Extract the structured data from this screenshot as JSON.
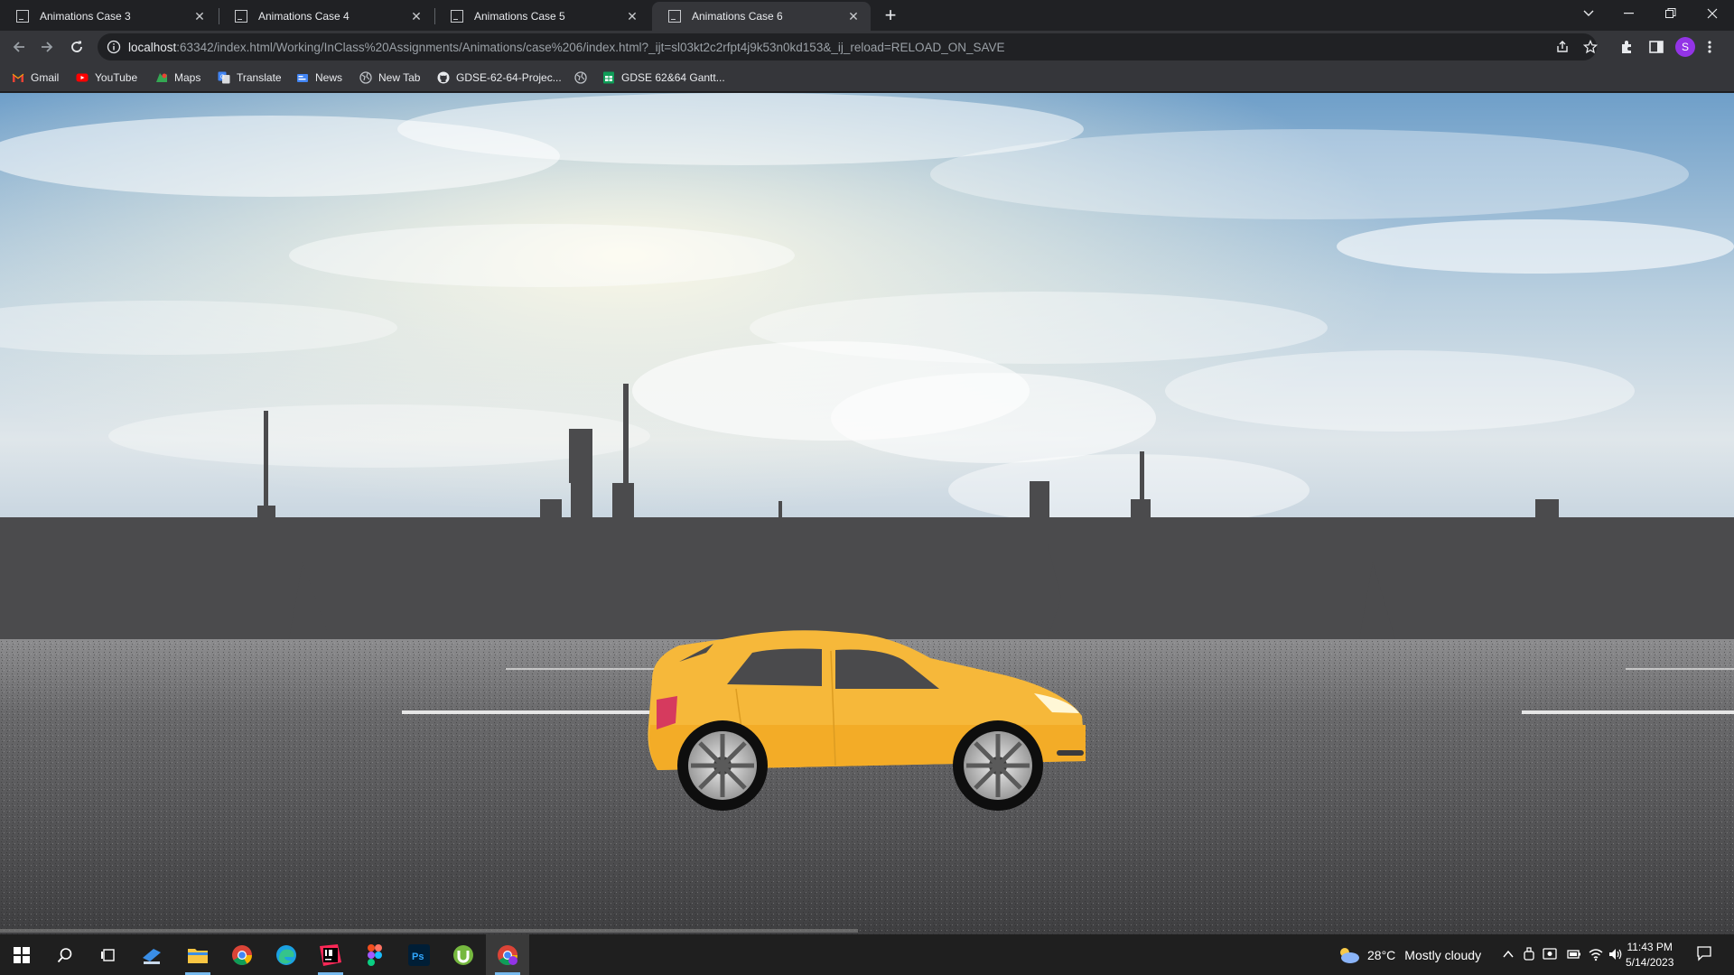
{
  "tabs": [
    {
      "label": "Animations Case 3",
      "active": false
    },
    {
      "label": "Animations Case 4",
      "active": false
    },
    {
      "label": "Animations Case 5",
      "active": false
    },
    {
      "label": "Animations Case 6",
      "active": true
    }
  ],
  "address_bar": {
    "host": "localhost",
    "path": ":63342/index.html/Working/InClass%20Assignments/Animations/case%206/index.html?_ijt=sl03kt2c2rfpt4j9k53n0kd153&_ij_reload=RELOAD_ON_SAVE"
  },
  "profile_initial": "S",
  "bookmarks": [
    {
      "label": "Gmail",
      "icon": "gmail-icon"
    },
    {
      "label": "YouTube",
      "icon": "youtube-icon"
    },
    {
      "label": "Maps",
      "icon": "maps-icon"
    },
    {
      "label": "Translate",
      "icon": "translate-icon"
    },
    {
      "label": "News",
      "icon": "news-icon"
    },
    {
      "label": "New Tab",
      "icon": "globe-icon"
    },
    {
      "label": "GDSE-62-64-Projec...",
      "icon": "github-icon"
    },
    {
      "label": "",
      "icon": "globe-icon"
    },
    {
      "label": "GDSE 62&64 Gantt...",
      "icon": "sheets-icon"
    }
  ],
  "taskbar": {
    "weather_temp": "28°C",
    "weather_text": "Mostly cloudy",
    "time": "11:43 PM",
    "date": "5/14/2023"
  },
  "colors": {
    "car_body": "#f6b83a",
    "car_window": "#4a4a4c",
    "buildings": "#4b4b4d",
    "road": "#5a5a5c",
    "sky_top": "#6f9fc9"
  }
}
